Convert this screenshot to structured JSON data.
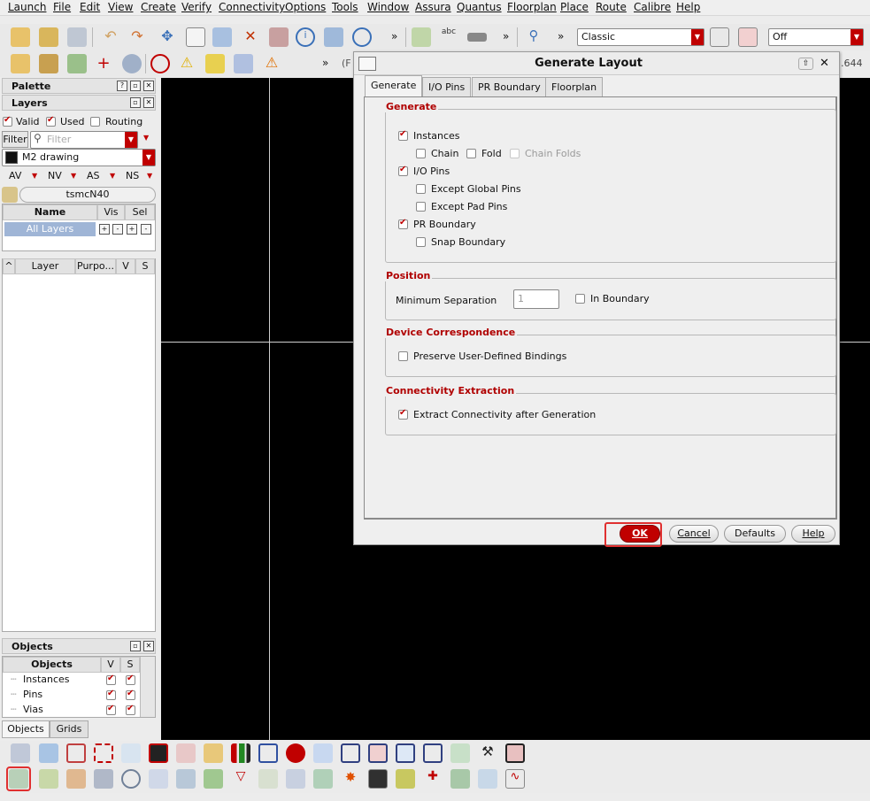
{
  "menubar": [
    "Launch",
    "File",
    "Edit",
    "View",
    "Create",
    "Verify",
    "Connectivity",
    "Options",
    "Tools",
    "Window",
    "Assura",
    "Quantus",
    "Floorplan",
    "Place",
    "Route",
    "Calibre",
    "Help"
  ],
  "toolbar": {
    "workspace_value": "Classic",
    "mode_value": "Off",
    "coord_fragment": "(F",
    "coord_value": ".644"
  },
  "palette": {
    "title": "Palette",
    "layers_title": "Layers",
    "valid_label": "Valid",
    "used_label": "Used",
    "routing_label": "Routing",
    "filter_label": "Filter",
    "filter_placeholder": "Filter",
    "layer_value": "M2 drawing",
    "toggles": [
      "AV",
      "NV",
      "AS",
      "NS"
    ],
    "tech": "tsmcN40",
    "cols": {
      "name": "Name",
      "vis": "Vis",
      "sel": "Sel"
    },
    "all_layers": "All Layers",
    "layer_cols": {
      "layer": "Layer",
      "purpose": "Purpo...",
      "v": "V",
      "s": "S"
    }
  },
  "objects_panel": {
    "title": "Objects",
    "cols": {
      "objects": "Objects",
      "v": "V",
      "s": "S"
    },
    "rows": [
      "Instances",
      "Pins",
      "Vias"
    ],
    "tabs": [
      "Objects",
      "Grids"
    ]
  },
  "dialog": {
    "title": "Generate Layout",
    "tabs": [
      "Generate",
      "I/O Pins",
      "PR Boundary",
      "Floorplan"
    ],
    "generate_group": "Generate",
    "instances": "Instances",
    "chain": "Chain",
    "fold": "Fold",
    "chain_folds": "Chain Folds",
    "io_pins": "I/O Pins",
    "except_global": "Except Global Pins",
    "except_pad": "Except Pad Pins",
    "pr_boundary": "PR Boundary",
    "snap_boundary": "Snap Boundary",
    "position_group": "Position",
    "min_sep_label": "Minimum Separation",
    "min_sep_value": "1",
    "in_boundary": "In Boundary",
    "device_group": "Device Correspondence",
    "preserve": "Preserve User-Defined Bindings",
    "conn_group": "Connectivity Extraction",
    "extract": "Extract Connectivity after Generation",
    "ok": "OK",
    "cancel": "Cancel",
    "defaults": "Defaults",
    "help": "Help"
  },
  "colors": {
    "accent": "#c00000",
    "canvas": "#000000",
    "highlight": "#e03030"
  }
}
